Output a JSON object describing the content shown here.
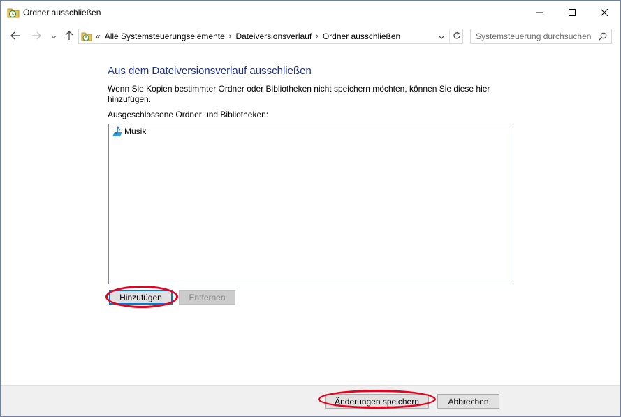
{
  "window": {
    "title": "Ordner ausschließen",
    "title_icon": "file-history-icon"
  },
  "caption_buttons": {
    "minimize_icon": "minimize-icon",
    "maximize_icon": "maximize-icon",
    "close_icon": "close-icon"
  },
  "navigation": {
    "back_icon": "arrow-left-icon",
    "forward_icon": "arrow-right-icon",
    "recent_icon": "chevron-down-icon",
    "up_icon": "arrow-up-icon"
  },
  "address_bar": {
    "overflow": "«",
    "breadcrumbs": [
      "Alle Systemsteuerungselemente",
      "Dateiversionsverlauf",
      "Ordner ausschließen"
    ],
    "separator": "›"
  },
  "search": {
    "placeholder": "Systemsteuerung durchsuchen"
  },
  "main": {
    "heading": "Aus dem Dateiversionsverlauf ausschließen",
    "description": "Wenn Sie Kopien bestimmter Ordner oder Bibliotheken nicht speichern möchten, können Sie diese hier hinzufügen.",
    "list_label": "Ausgeschlossene Ordner und Bibliotheken:",
    "excluded_items": [
      {
        "label": "Musik",
        "icon": "music-library-icon"
      }
    ],
    "add_button": "Hinzufügen",
    "remove_button": "Entfernen"
  },
  "footer": {
    "save_button": "Änderungen speichern",
    "cancel_button": "Abbrechen"
  },
  "colors": {
    "heading": "#1e3287",
    "highlight": "#e8001c",
    "focus": "#0078d7",
    "footer_bg": "#f0f0f0"
  }
}
